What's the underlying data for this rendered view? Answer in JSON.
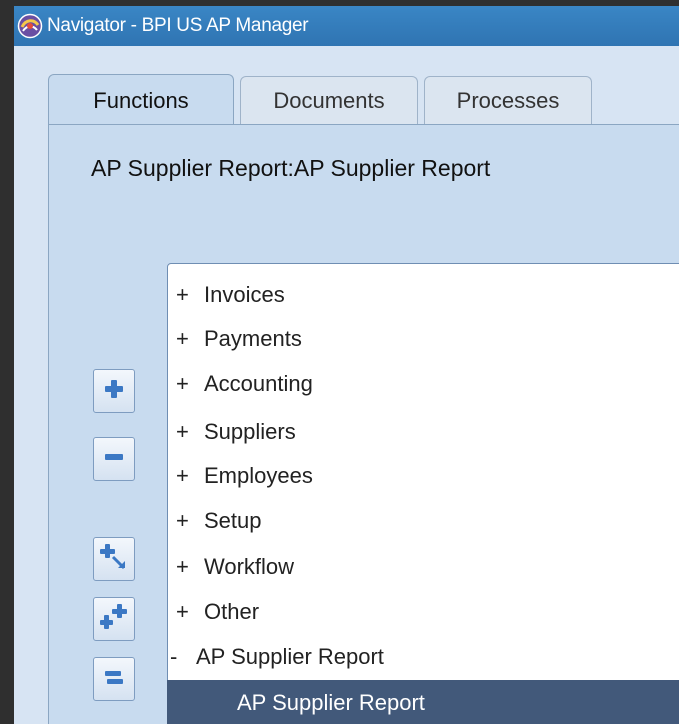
{
  "window": {
    "title": "Navigator - BPI US AP Manager"
  },
  "tabs": [
    {
      "label": "Functions",
      "active": true
    },
    {
      "label": "Documents",
      "active": false
    },
    {
      "label": "Processes",
      "active": false
    }
  ],
  "main": {
    "heading": "AP Supplier Report:AP Supplier Report"
  },
  "side_buttons": [
    {
      "name": "expand-icon"
    },
    {
      "name": "collapse-icon"
    },
    {
      "name": "expand-branch-icon"
    },
    {
      "name": "expand-all-icon"
    },
    {
      "name": "collapse-all-icon"
    }
  ],
  "tree": {
    "items": [
      {
        "expander": "+",
        "label": "Invoices"
      },
      {
        "expander": "+",
        "label": "Payments"
      },
      {
        "expander": "+",
        "label": "Accounting"
      },
      {
        "expander": "+",
        "label": "Suppliers"
      },
      {
        "expander": "+",
        "label": "Employees"
      },
      {
        "expander": "+",
        "label": "Setup"
      },
      {
        "expander": "+",
        "label": "Workflow"
      },
      {
        "expander": "+",
        "label": "Other"
      },
      {
        "expander": "-",
        "label": "AP Supplier Report"
      },
      {
        "expander": "",
        "label": "AP Supplier Report",
        "selected": true
      }
    ]
  },
  "colors": {
    "titlebar": "#2f74b2",
    "panel": "#c8dbef",
    "selection": "#42597a"
  }
}
